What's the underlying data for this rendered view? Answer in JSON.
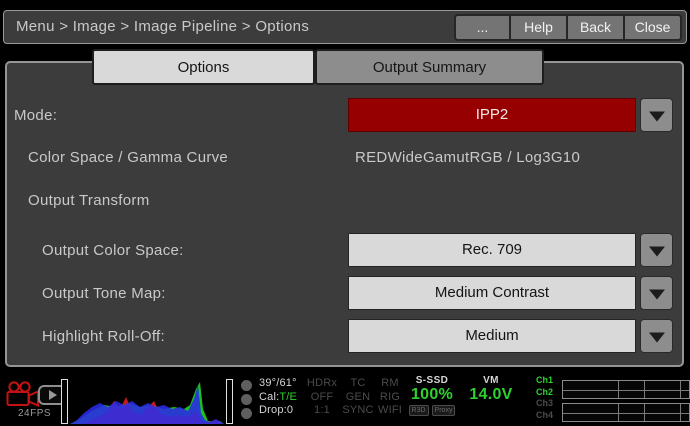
{
  "titlebar": {
    "breadcrumb": "Menu > Image > Image Pipeline > Options",
    "buttons": [
      "...",
      "Help",
      "Back",
      "Close"
    ]
  },
  "tabs": {
    "options": "Options",
    "output_summary": "Output Summary"
  },
  "form": {
    "mode": {
      "label": "Mode:",
      "value": "IPP2"
    },
    "color_space_gamma": {
      "label": "Color Space / Gamma Curve",
      "value": "REDWideGamutRGB / Log3G10"
    },
    "output_transform_label": "Output Transform",
    "output_color_space": {
      "label": "Output Color Space:",
      "value": "Rec. 709"
    },
    "output_tone_map": {
      "label": "Output Tone Map:",
      "value": "Medium Contrast"
    },
    "highlight_rolloff": {
      "label": "Highlight Roll-Off:",
      "value": "Medium"
    }
  },
  "statusbar": {
    "fps": "24FPS",
    "temps": "39°/61°",
    "cal_label": "Cal:",
    "cal_value": "T/E",
    "drop": "Drop:0",
    "col_hdrx": [
      "HDRx",
      "OFF",
      "1:1"
    ],
    "col_tc": [
      "TC",
      "GEN",
      "SYNC"
    ],
    "col_rm": [
      "RM",
      "RIG",
      "WIFI"
    ],
    "ssd": {
      "label": "S-SSD",
      "value": "100%"
    },
    "badges": [
      "R3D",
      "Proxy"
    ],
    "vm": {
      "label": "VM",
      "value": "14.0V"
    },
    "channels": [
      {
        "label": "Ch1",
        "active": true
      },
      {
        "label": "Ch2",
        "active": true
      },
      {
        "label": "Ch3",
        "active": false
      },
      {
        "label": "Ch4",
        "active": false
      }
    ]
  },
  "histogram": {
    "r": "12,45 24,40 36,34 44,22 50,30 56,18 62,32 70,36 78,28 84,22 90,34 100,38 108,36 118,38 126,32 132,42 138,44 144,41 150,43 154,45",
    "g": "0,45 10,40 22,32 34,26 46,28 58,24 70,28 82,26 94,30 104,28 114,30 120,26 126,10 130,3 133,30 138,42 146,43 150,42 154,45",
    "b": "0,45 6,42 14,34 22,28 30,24 38,28 46,22 54,26 62,22 70,28 78,24 86,28 94,26 102,30 110,28 118,32 124,20 128,6 131,34 135,41 140,43 146,40 151,43 154,45"
  },
  "colors": {
    "accent_red": "#970000",
    "status_green": "#2fd12f",
    "panel_gray": "#3c3c3c",
    "dropdown_light": "#d9d9d9"
  }
}
